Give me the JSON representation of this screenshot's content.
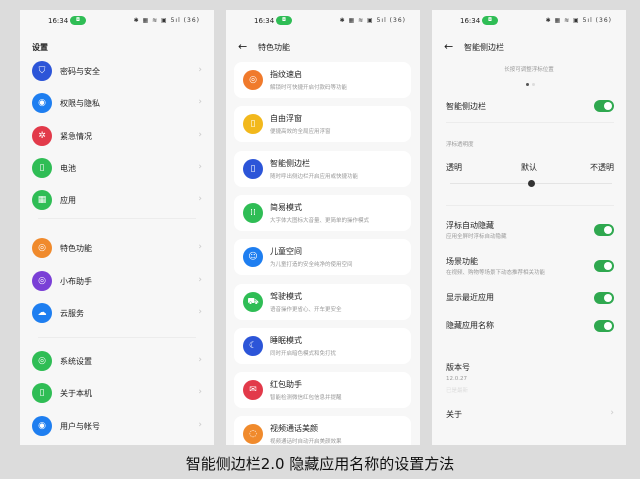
{
  "status": {
    "time": "16:34",
    "pill": "◘",
    "icons": "✱ ▦ ≋ ▣ 5ıl",
    "battery": "36"
  },
  "p1": {
    "title": "设置",
    "items": [
      {
        "label": "密码与安全",
        "color": "#2c55d8",
        "glyph": "⛉"
      },
      {
        "label": "权限与隐私",
        "color": "#1e7ef0",
        "glyph": "◉"
      },
      {
        "label": "紧急情况",
        "color": "#e23a4a",
        "glyph": "✲"
      },
      {
        "label": "电池",
        "color": "#2fbd55",
        "glyph": "▯"
      },
      {
        "label": "应用",
        "color": "#2fbd55",
        "glyph": "▦"
      },
      {
        "label": "特色功能",
        "color": "#f08a2c",
        "glyph": "◎"
      },
      {
        "label": "小布助手",
        "color": "#7a3fd6",
        "glyph": "◎"
      },
      {
        "label": "云服务",
        "color": "#1e7ef0",
        "glyph": "☁"
      },
      {
        "label": "系统设置",
        "color": "#2fbd55",
        "glyph": "◎"
      },
      {
        "label": "关于本机",
        "color": "#2fbd55",
        "glyph": "▯"
      },
      {
        "label": "用户与帐号",
        "color": "#1e7ef0",
        "glyph": "◉"
      }
    ]
  },
  "p2": {
    "title": "特色功能",
    "back": "←",
    "items": [
      {
        "label": "指纹速启",
        "sub": "解锁时可快捷开启付款码等功能",
        "color": "#f07a2c",
        "glyph": "◎"
      },
      {
        "label": "自由浮窗",
        "sub": "便捷高效的全局应用浮窗",
        "color": "#f2b81c",
        "glyph": "▯"
      },
      {
        "label": "智能侧边栏",
        "sub": "随时呼出侧边栏开启应用或快捷功能",
        "color": "#2c55d8",
        "glyph": "▯"
      },
      {
        "label": "简易模式",
        "sub": "大字体大图标大音量、更简单的操作模式",
        "color": "#2fbd55",
        "glyph": "⁞⁞"
      },
      {
        "label": "儿童空间",
        "sub": "为儿童打造的安全纯净的使用空间",
        "color": "#1e7ef0",
        "glyph": "☺"
      },
      {
        "label": "驾驶模式",
        "sub": "语音操作更省心、开车更安全",
        "color": "#2fbd55",
        "glyph": "⛟"
      },
      {
        "label": "睡眠模式",
        "sub": "同时开启暗色模式和免打扰",
        "color": "#2c55d8",
        "glyph": "☾"
      },
      {
        "label": "红包助手",
        "sub": "智能检测微信红包信息并提醒",
        "color": "#e23a4a",
        "glyph": "✉"
      },
      {
        "label": "视频通话美颜",
        "sub": "视频通话时自动开启美颜效果",
        "color": "#f08a2c",
        "glyph": "◌"
      }
    ]
  },
  "p3": {
    "title": "智能侧边栏",
    "back": "←",
    "hint": "长按可调整浮标位置",
    "main_toggle": "智能侧边栏",
    "opacity_label": "浮标透明度",
    "slider": {
      "left": "透明",
      "mid": "默认",
      "right": "不透明",
      "value": 0.5
    },
    "toggles": [
      {
        "label": "浮标自动隐藏",
        "sub": "应用全屏时浮标自动隐藏",
        "on": true
      },
      {
        "label": "场景功能",
        "sub": "在视频、购物等场景下动态推荐相关功能",
        "on": true
      },
      {
        "label": "显示最近应用",
        "sub": "",
        "on": true
      },
      {
        "label": "隐藏应用名称",
        "sub": "",
        "on": true
      }
    ],
    "version_label": "版本号",
    "version": "12.0.27",
    "version_status": "已是最新",
    "about": "关于"
  },
  "caption": "智能侧边栏2.0 隐藏应用名称的设置方法"
}
